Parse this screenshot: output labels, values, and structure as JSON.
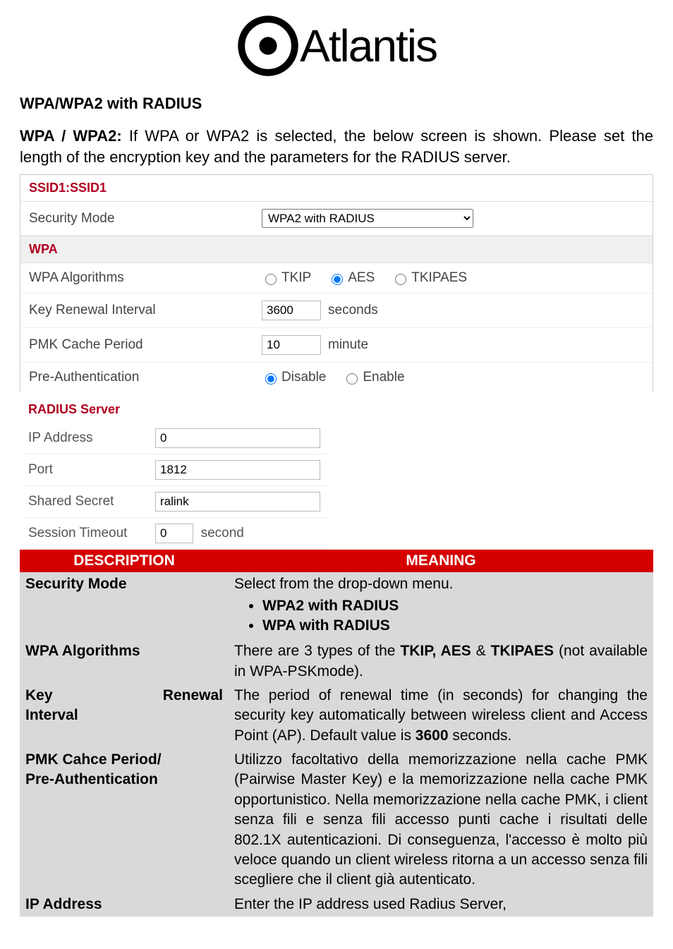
{
  "logo": {
    "text": "Atlantis"
  },
  "heading": "WPA/WPA2 with RADIUS",
  "intro_lead": "WPA / WPA2:",
  "intro_rest": " If WPA or WPA2 is selected, the below screen is shown.  Please set the length of the encryption key and the parameters for the RADIUS server.",
  "form": {
    "ssid_label": "SSID1:SSID1",
    "security_mode_label": "Security Mode",
    "security_mode_value": "WPA2 with RADIUS",
    "wpa_header": "WPA",
    "wpa_alg_label": "WPA Algorithms",
    "alg_tkip": "TKIP",
    "alg_aes": "AES",
    "alg_tkipaes": "TKIPAES",
    "key_renewal_label": "Key Renewal Interval",
    "key_renewal_value": "3600",
    "seconds": "seconds",
    "pmk_label": "PMK Cache Period",
    "pmk_value": "10",
    "minute": "minute",
    "preauth_label": "Pre-Authentication",
    "disable": "Disable",
    "enable": "Enable",
    "radius_header": "RADIUS Server",
    "ip_label": "IP Address",
    "ip_value": "0",
    "port_label": "Port",
    "port_value": "1812",
    "secret_label": "Shared Secret",
    "secret_value": "ralink",
    "session_label": "Session Timeout",
    "session_value": "0",
    "second_unit": "second"
  },
  "table": {
    "hdr_desc": "DESCRIPTION",
    "hdr_mean": "MEANING",
    "rows": {
      "r1_label": "Security Mode",
      "r1_text": "Select from the drop-down menu.",
      "r1_li1": "WPA2 with RADIUS",
      "r1_li2": "WPA with RADIUS",
      "r2_label": "WPA Algorithms",
      "r2_text_a": "There are 3 types of the ",
      "r2_b1": "TKIP, AES",
      "r2_mid": " & ",
      "r2_b2": "TKIPAES",
      "r2_text_b": " (not available in WPA-PSKmode).",
      "r3_label_a": "Key",
      "r3_label_b": "Renewal",
      "r3_label_c": "Interval",
      "r3_text_a": "The period of renewal time (in seconds) for changing the security key automatically between wireless client and Access Point (AP). Default value is ",
      "r3_b": "3600",
      "r3_text_b": " seconds.",
      "r4_label_a": "PMK Cahce Period/",
      "r4_label_b": "Pre-Authentication",
      "r4_text": "Utilizzo facoltativo della memorizzazione nella cache PMK (Pairwise Master Key) e la memorizzazione nella cache PMK opportunistico. Nella memorizzazione nella cache PMK, i client senza fili e senza fili accesso punti cache i risultati delle 802.1X autenticazioni. Di conseguenza, l'accesso è molto più veloce quando un client wireless ritorna a un accesso senza fili scegliere che il client già autenticato.",
      "r5_label": "IP Address",
      "r5_text": "Enter the IP address used Radius Server,"
    }
  }
}
